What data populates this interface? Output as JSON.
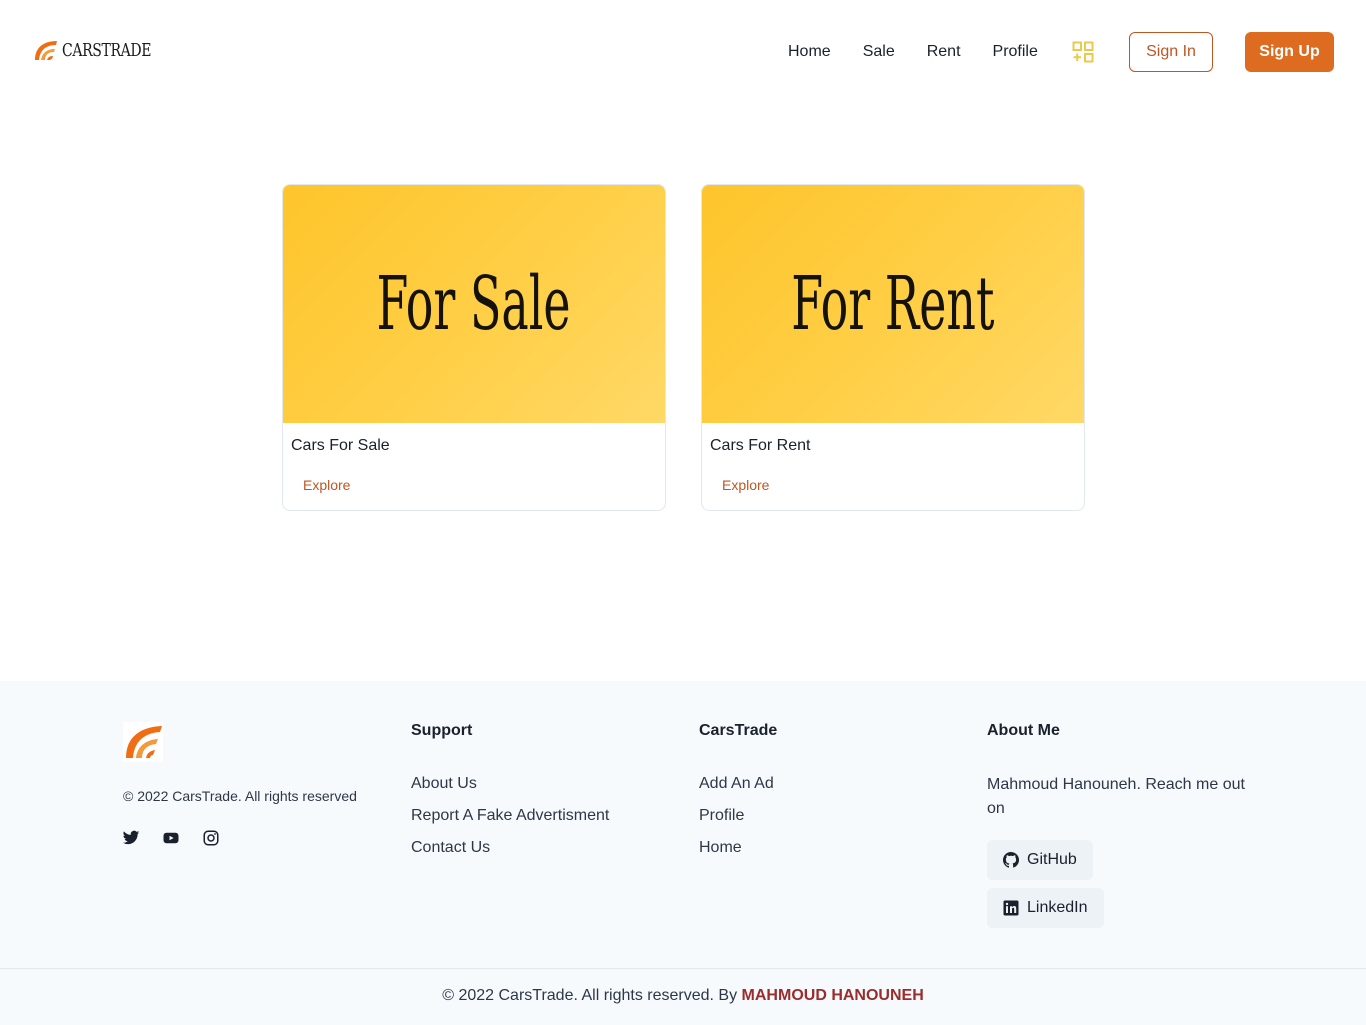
{
  "header": {
    "logo_text": "CARSTRADE",
    "nav": [
      "Home",
      "Sale",
      "Rent",
      "Profile"
    ],
    "add_icon": "grid-plus-icon",
    "signin_label": "Sign In",
    "signup_label": "Sign Up"
  },
  "cards": [
    {
      "image_text": "For Sale",
      "title": "Cars For Sale",
      "link": "Explore"
    },
    {
      "image_text": "For Rent",
      "title": "Cars For Rent",
      "link": "Explore"
    }
  ],
  "footer": {
    "copyright": "© 2022 CarsTrade. All rights reserved",
    "social": [
      "twitter-icon",
      "youtube-icon",
      "instagram-icon"
    ],
    "support": {
      "title": "Support",
      "links": [
        "About Us",
        "Report A Fake Advertisment",
        "Contact Us"
      ]
    },
    "carstrade": {
      "title": "CarsTrade",
      "links": [
        "Add An Ad",
        "Profile",
        "Home"
      ]
    },
    "about": {
      "title": "About Me",
      "text": "Mahmoud Hanouneh. Reach me out on",
      "github_label": "GitHub",
      "linkedin_label": "LinkedIn"
    },
    "bottom_prefix": "© 2022 CarsTrade. All rights reserved. By ",
    "bottom_author": "MAHMOUD HANOUNEH"
  },
  "colors": {
    "accent": "#dd6b20",
    "accent_dark": "#c05621",
    "card_yellow": "#fec52b",
    "author": "#9b2c2c"
  }
}
